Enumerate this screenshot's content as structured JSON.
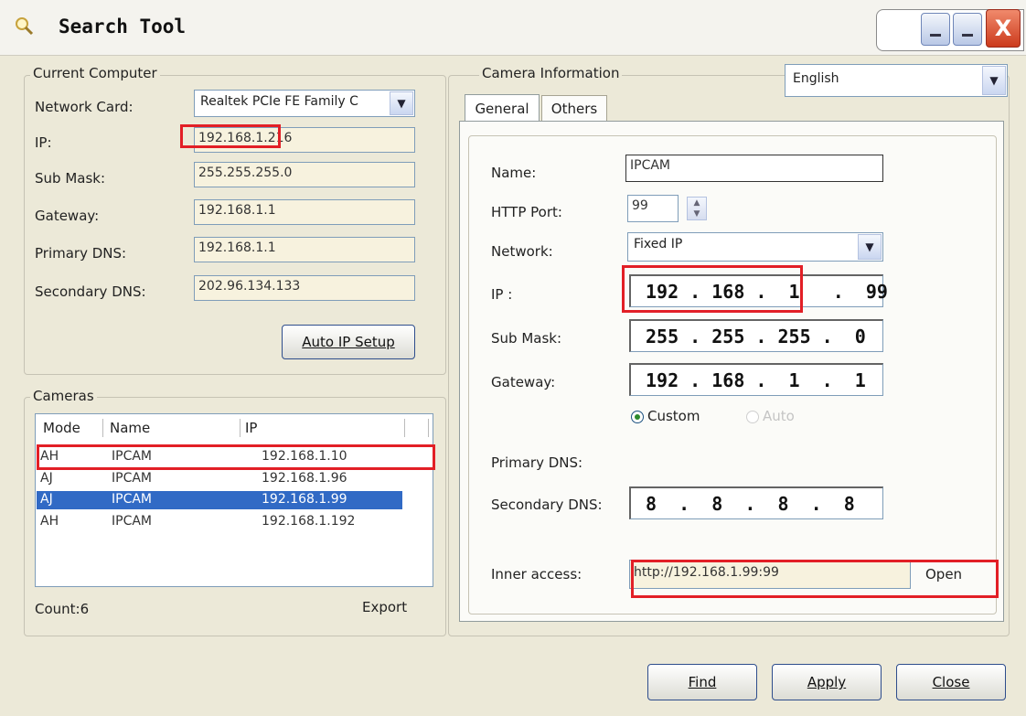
{
  "window": {
    "title": "Search Tool",
    "minimize": "_",
    "maximize": "_",
    "close": "X"
  },
  "current_computer": {
    "legend": "Current Computer",
    "network_card_label": "Network Card:",
    "network_card_value": "Realtek PCIe FE Family C",
    "ip_label": "IP:",
    "ip_value": "192.168.1.216",
    "submask_label": "Sub Mask:",
    "submask_value": "255.255.255.0",
    "gateway_label": "Gateway:",
    "gateway_value": "192.168.1.1",
    "primary_dns_label": "Primary DNS:",
    "primary_dns_value": "192.168.1.1",
    "secondary_dns_label": "Secondary DNS:",
    "secondary_dns_value": "202.96.134.133",
    "auto_ip_button": "Auto IP Setup"
  },
  "cameras": {
    "legend": "Cameras",
    "columns": [
      "Mode",
      "Name",
      "IP"
    ],
    "rows": [
      {
        "mode": "AH",
        "name": "IPCAM",
        "ip": "192.168.1.10"
      },
      {
        "mode": "AJ",
        "name": "IPCAM",
        "ip": "192.168.1.96"
      },
      {
        "mode": "AJ",
        "name": "IPCAM",
        "ip": "192.168.1.99"
      },
      {
        "mode": "AH",
        "name": "IPCAM",
        "ip": "192.168.1.192"
      }
    ],
    "selected_row": 2,
    "count_label": "Count:6",
    "export_label": "Export"
  },
  "language": {
    "selected": "English"
  },
  "camera_info": {
    "legend": "Camera Information",
    "tabs": [
      "General",
      "Others"
    ],
    "name_label": "Name:",
    "name_value": "IPCAM",
    "http_port_label": "HTTP Port:",
    "http_port_value": "99",
    "network_label": "Network:",
    "network_value": "Fixed IP",
    "ip_label": "IP :",
    "ip_value": "192 . 168 .  1   .  99",
    "submask_label": "Sub Mask:",
    "submask_value": "255 . 255 . 255 .  0",
    "gateway_label": "Gateway:",
    "gateway_value": "192 . 168 .  1  .  1",
    "custom_label": "Custom",
    "auto_label": "Auto",
    "primary_dns_label": "Primary DNS:",
    "secondary_dns_label": "Secondary DNS:",
    "secondary_dns_value": "8  .  8  .  8  .  8",
    "inner_access_label": "Inner access:",
    "inner_access_value": "http://192.168.1.99:99",
    "open_label": "Open"
  },
  "footer": {
    "find": "Find",
    "apply": "Apply",
    "close": "Close"
  },
  "colors": {
    "highlight": "#e21f26",
    "selection": "#316ac5",
    "field_bg": "#f7f2de"
  }
}
